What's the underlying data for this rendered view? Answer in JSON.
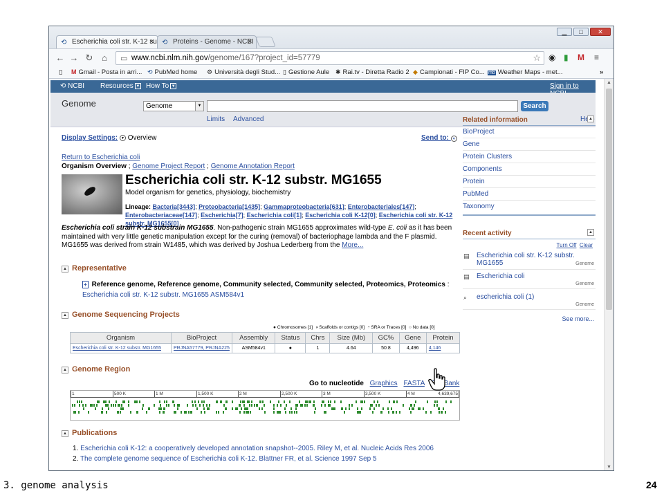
{
  "browser": {
    "tabs": [
      {
        "label": "Escherichia coli str. K-12 su"
      },
      {
        "label": "Proteins - Genome - NCBI"
      }
    ],
    "url_host": "www.ncbi.nlm.nih.gov",
    "url_path": "/genome/167?project_id=57779",
    "bookmarks": [
      {
        "label": "Gmail - Posta in arri..."
      },
      {
        "label": "PubMed home"
      },
      {
        "label": "Università degli Stud..."
      },
      {
        "label": "Gestione Aule"
      },
      {
        "label": "Rai.tv - Diretta Radio 2"
      },
      {
        "label": "Campionati - FIP Co..."
      },
      {
        "label": "Weather Maps - met..."
      }
    ],
    "bookmarks_more": "»"
  },
  "ncbi": {
    "logo": "NCBI",
    "resources": "Resources",
    "howto": "How To",
    "signin": "Sign in to NCBI",
    "db_title": "Genome",
    "db_select": "Genome",
    "search_btn": "Search",
    "limits": "Limits",
    "advanced": "Advanced",
    "help": "Help"
  },
  "page": {
    "display_settings": "Display Settings:",
    "display_mode": "Overview",
    "send_to": "Send to:",
    "return_link": "Return to Escherichia coli",
    "overview_label": "Organism Overview",
    "overview_sep": ";",
    "gp_report": "Genome Project Report",
    "ga_report": "Genome Annotation Report",
    "org_title": "Escherichia coli str. K-12 substr. MG1655",
    "org_sub": "Model organism for genetics, physiology, biochemistry",
    "lineage_label": "Lineage:",
    "lineage_items": [
      "Bacteria[3443]",
      "Proteobacteria[1435]",
      "Gammaproteobacteria[631]",
      "Enterobacteriales[147]",
      "Enterobacteriaceae[147]",
      "Escherichia[7]",
      "Escherichia coli[1]",
      "Escherichia coli K-12[0]",
      "Escherichia coli str. K-12 substr. MG1655[0]"
    ],
    "desc_bold": "Escherichia coli strain K-12 substrain MG1655",
    "desc_text_1": ". Non-pathogenic strain MG1655 approximates wild-type ",
    "desc_italic": "E. coli",
    "desc_text_2": " as it has been maintained with very little genetic manipulation except for the curing (removal) of bacteriophage lambda and the F plasmid. MG1655 was derived from strain W1485, which was derived by Joshua Lederberg from the ",
    "desc_more": "More..."
  },
  "representative": {
    "heading": "Representative",
    "ref_text": "Reference genome, Reference genome, Community selected, Community selected, Proteomics, Proteomics",
    "ref_colon": ":",
    "assembly_link": "Escherichia coli str. K-12 substr. MG1655 ASM584v1"
  },
  "gsp": {
    "heading": "Genome Sequencing Projects",
    "legend": [
      {
        "symbol": "●",
        "label": "Chromosomes [1]"
      },
      {
        "symbol": "◑",
        "label": "Scaffolds or contigs [0]"
      },
      {
        "symbol": "◔",
        "label": "SRA or Traces [0]"
      },
      {
        "symbol": "○",
        "label": "No data [0]"
      }
    ],
    "columns": [
      "Organism",
      "BioProject",
      "Assembly",
      "Status",
      "Chrs",
      "Size (Mb)",
      "GC%",
      "Gene",
      "Protein"
    ],
    "rows": [
      {
        "organism": "Escherichia coli str. K-12 substr. MG1655",
        "bioproject": "PRJNA57779, PRJNA225",
        "assembly": "ASM584v1",
        "status": "●",
        "chrs": "1",
        "size": "4.64",
        "gc": "50.8",
        "gene": "4,496",
        "protein": "4,146"
      }
    ]
  },
  "region": {
    "heading": "Genome Region",
    "goto": "Go to nucleotide",
    "graphics": "Graphics",
    "fasta": "FASTA",
    "genbank": "GenBank",
    "ruler_labels": [
      "1",
      "500 K",
      "1 M",
      "1,500 K",
      "2 M",
      "2,500 K",
      "3 M",
      "3,500 K",
      "4 M",
      "4,639,675"
    ]
  },
  "publications": {
    "heading": "Publications",
    "items": [
      {
        "num": "1.",
        "text": "Escherichia coli K-12: a cooperatively developed annotation snapshot--2005. Riley M, et al. Nucleic Acids Res 2006"
      },
      {
        "num": "2.",
        "text": "The complete genome sequence of Escherichia coli K-12. Blattner FR, et al. Science 1997 Sep 5"
      }
    ]
  },
  "sidebar": {
    "related_heading": "Related information",
    "related_items": [
      "BioProject",
      "Gene",
      "Protein Clusters",
      "Components",
      "Protein",
      "PubMed",
      "Taxonomy"
    ],
    "recent_heading": "Recent activity",
    "turn_off": "Turn Off",
    "clear": "Clear",
    "recent_items": [
      {
        "text": "Escherichia coli str. K-12 substr. MG1655",
        "db": "Genome"
      },
      {
        "text": "Escherichia coli",
        "db": "Genome"
      },
      {
        "text": "escherichia coli (1)",
        "db": "Genome"
      }
    ],
    "see_more": "See more..."
  },
  "slide": {
    "footer_left": "3. genome analysis",
    "page_number": "24"
  },
  "colors": {
    "ncbi_blue": "#3a6896",
    "section_heading": "#98512a",
    "link": "#2b4fa0",
    "gene_green": "#2e8b2e"
  }
}
